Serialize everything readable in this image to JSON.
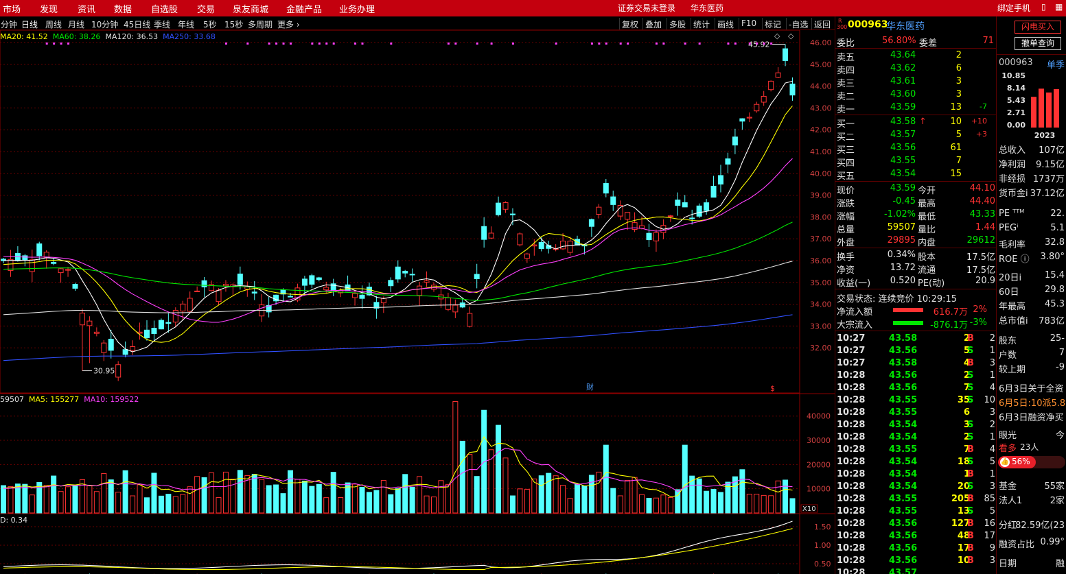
{
  "menu": {
    "items": [
      "市场",
      "发现",
      "资讯",
      "数据",
      "自选股",
      "交易",
      "泉友商城",
      "金融产品",
      "业务办理"
    ],
    "login_status": "证券交易未登录",
    "stock_title": "华东医药",
    "bind_phone": "绑定手机"
  },
  "periods": {
    "items": [
      "分钟",
      "日线",
      "周线",
      "月线",
      "10分钟",
      "45日线",
      "季线",
      "年线",
      "5秒",
      "15秒",
      "多周期",
      "更多 ›"
    ],
    "active": "日线",
    "tools": [
      "复权",
      "叠加",
      "多股",
      "统计",
      "画线",
      "F10",
      "标记",
      "-自选",
      "返回"
    ]
  },
  "ma_legend": [
    {
      "text": "MA20: 41.52",
      "color": "#ffff00"
    },
    {
      "text": "MA60: 38.26",
      "color": "#00e600"
    },
    {
      "text": "MA120: 36.53",
      "color": "#e0e0e0"
    },
    {
      "text": "MA250: 33.68",
      "color": "#3050ff"
    }
  ],
  "vol_legend": [
    {
      "text": "59507",
      "color": "#e0e0e0"
    },
    {
      "text": "MA5: 155277",
      "color": "#ffff00"
    },
    {
      "text": "MA10: 159522",
      "color": "#ff40ff"
    }
  ],
  "ind_legend": "D: 0.34",
  "chart_data": {
    "type": "candlestick",
    "price_axis": {
      "ticks": [
        "46.00",
        "45.00",
        "44.00",
        "43.00",
        "42.00",
        "41.00",
        "40.00",
        "39.00",
        "38.00",
        "37.00",
        "36.00",
        "35.00",
        "34.00",
        "33.00",
        "32.00"
      ]
    },
    "high_label": "45.92",
    "low_label": "30.95",
    "volume_axis": {
      "ticks": [
        "40000",
        "30000",
        "20000",
        "10000"
      ],
      "unit": "X10"
    },
    "ind_axis": {
      "ticks": [
        "1.50",
        "1.00",
        "0.50"
      ]
    },
    "markers": {
      "fin": "财",
      "div": "$"
    }
  },
  "quote": {
    "code": "000963",
    "name": "华东医药",
    "badge_top": "R",
    "badge_bottom": "300",
    "weibi_label": "委比",
    "weibi_value": "56.80%",
    "weicha_label": "委差",
    "weicha_value": "71",
    "asks": [
      {
        "label": "卖五",
        "price": "43.64",
        "vol": "2",
        "chg": ""
      },
      {
        "label": "卖四",
        "price": "43.62",
        "vol": "6",
        "chg": ""
      },
      {
        "label": "卖三",
        "price": "43.61",
        "vol": "3",
        "chg": ""
      },
      {
        "label": "卖二",
        "price": "43.60",
        "vol": "3",
        "chg": ""
      },
      {
        "label": "卖一",
        "price": "43.59",
        "vol": "13",
        "chg": "-7"
      }
    ],
    "bids": [
      {
        "label": "买一",
        "price": "43.58",
        "arrow": "↑",
        "vol": "10",
        "chg": "+10"
      },
      {
        "label": "买二",
        "price": "43.57",
        "arrow": "",
        "vol": "5",
        "chg": "+3"
      },
      {
        "label": "买三",
        "price": "43.56",
        "arrow": "",
        "vol": "61",
        "chg": ""
      },
      {
        "label": "买四",
        "price": "43.55",
        "arrow": "",
        "vol": "7",
        "chg": ""
      },
      {
        "label": "买五",
        "price": "43.54",
        "arrow": "",
        "vol": "15",
        "chg": ""
      }
    ],
    "stats": [
      {
        "l1": "现价",
        "v1": "43.59",
        "c1": "green",
        "l2": "今开",
        "v2": "44.10",
        "c2": "red"
      },
      {
        "l1": "涨跌",
        "v1": "-0.45",
        "c1": "green",
        "l2": "最高",
        "v2": "44.40",
        "c2": "red"
      },
      {
        "l1": "涨幅",
        "v1": "-1.02%",
        "c1": "green",
        "l2": "最低",
        "v2": "43.33",
        "c2": "green"
      },
      {
        "l1": "总量",
        "v1": "59507",
        "c1": "yellow",
        "l2": "量比",
        "v2": "1.44",
        "c2": "red"
      },
      {
        "l1": "外盘",
        "v1": "29895",
        "c1": "red",
        "l2": "内盘",
        "v2": "29612",
        "c2": "green"
      }
    ],
    "stats2": [
      {
        "l1": "换手",
        "v1": "0.34%",
        "l2": "股本",
        "v2": "17.5亿"
      },
      {
        "l1": "净资",
        "v1": "13.72",
        "l2": "流通",
        "v2": "17.5亿"
      },
      {
        "l1": "收益(一)",
        "v1": "0.520",
        "l2": "PE(动)",
        "v2": "20.9"
      }
    ],
    "trade_status": "交易状态: 连续竞价 10:29:15",
    "flows": [
      {
        "label": "净流入额",
        "value": "616.7万",
        "pct": "2%",
        "color": "#ff3232"
      },
      {
        "label": "大宗流入",
        "value": "-876.1万",
        "pct": "-3%",
        "color": "#00e600"
      }
    ],
    "ticks": [
      {
        "t": "10:27",
        "p": "43.58",
        "v": "2",
        "s": "B",
        "n": "2"
      },
      {
        "t": "10:27",
        "p": "43.56",
        "v": "5",
        "s": "S",
        "n": "1"
      },
      {
        "t": "10:27",
        "p": "43.58",
        "v": "4",
        "s": "B",
        "n": "3"
      },
      {
        "t": "10:28",
        "p": "43.56",
        "v": "2",
        "s": "S",
        "n": "1"
      },
      {
        "t": "10:28",
        "p": "43.56",
        "v": "7",
        "s": "S",
        "n": "4"
      },
      {
        "t": "10:28",
        "p": "43.55",
        "v": "35",
        "s": "S",
        "n": "10"
      },
      {
        "t": "10:28",
        "p": "43.55",
        "v": "6",
        "s": "",
        "n": "3"
      },
      {
        "t": "10:28",
        "p": "43.54",
        "v": "3",
        "s": "S",
        "n": "2"
      },
      {
        "t": "10:28",
        "p": "43.54",
        "v": "2",
        "s": "S",
        "n": "1"
      },
      {
        "t": "10:28",
        "p": "43.55",
        "v": "7",
        "s": "B",
        "n": "4"
      },
      {
        "t": "10:28",
        "p": "43.54",
        "v": "18",
        "s": "S",
        "n": "5"
      },
      {
        "t": "10:28",
        "p": "43.54",
        "v": "1",
        "s": "B",
        "n": "1"
      },
      {
        "t": "10:28",
        "p": "43.54",
        "v": "20",
        "s": "S",
        "n": "3"
      },
      {
        "t": "10:28",
        "p": "43.55",
        "v": "205",
        "s": "B",
        "n": "85"
      },
      {
        "t": "10:28",
        "p": "43.55",
        "v": "13",
        "s": "S",
        "n": "5"
      },
      {
        "t": "10:28",
        "p": "43.56",
        "v": "127",
        "s": "B",
        "n": "16"
      },
      {
        "t": "10:28",
        "p": "43.56",
        "v": "48",
        "s": "B",
        "n": "17"
      },
      {
        "t": "10:28",
        "p": "43.56",
        "v": "17",
        "s": "B",
        "n": "9"
      },
      {
        "t": "10:28",
        "p": "43.56",
        "v": "10",
        "s": "B",
        "n": "3"
      },
      {
        "t": "10:28",
        "p": "43.57",
        "v": "",
        "s": "",
        "n": ""
      }
    ]
  },
  "right_panel": {
    "btn_buy": "闪电买入",
    "btn_cancel": "撤单查询",
    "code": "000963",
    "tab": "单季",
    "mini_axis": [
      "10.85",
      "8.14",
      "5.43",
      "2.71",
      "0.00"
    ],
    "mini_bars": [
      6.4,
      8.1,
      7.3,
      8.0
    ],
    "mini_year": "2023",
    "fin": [
      {
        "l": "总收入",
        "v": "107亿"
      },
      {
        "l": "净利润",
        "v": "9.15亿"
      },
      {
        "l": "非经损",
        "v": "1737万"
      },
      {
        "l": "货币金i",
        "v": "37.12亿"
      }
    ],
    "ratios": [
      {
        "l": "PE ᵀᵀᴹ",
        "v": "22."
      },
      {
        "l": "PEGⁱ",
        "v": "5.1"
      },
      {
        "l": "毛利率",
        "v": "32.8"
      },
      {
        "l": "ROE ⓘ",
        "v": "3.80°"
      }
    ],
    "perf": [
      {
        "l": "20日i",
        "v": "15.4"
      },
      {
        "l": "60日",
        "v": "29.8"
      },
      {
        "l": "年最高",
        "v": "45.3"
      },
      {
        "l": "总市值i",
        "v": "783亿"
      }
    ],
    "holders": [
      {
        "l": "股东",
        "v": "25-"
      },
      {
        "l": "户数",
        "v": "7"
      },
      {
        "l": "较上期",
        "v": "-9"
      }
    ],
    "news": [
      {
        "text": "6月3日关于全资",
        "color": "#e0e0e0"
      },
      {
        "text": "6月5日:10派5.8",
        "color": "#ff9030"
      },
      {
        "text": "6月3日融资净买",
        "color": "#e0e0e0"
      }
    ],
    "vision_label": "眼光",
    "vision_today": "今",
    "bull_label": "看多",
    "bull_count": "23人",
    "bull_pct": "56%",
    "inst": [
      {
        "l": "基金",
        "v": "55家"
      },
      {
        "l": "法人1",
        "v": "2家"
      }
    ],
    "dividend_label": "分红",
    "dividend_value": "82.59亿(23",
    "margin_label": "融资占比",
    "margin_value": "0.99°",
    "date_label": "日期",
    "date_value": "融"
  }
}
